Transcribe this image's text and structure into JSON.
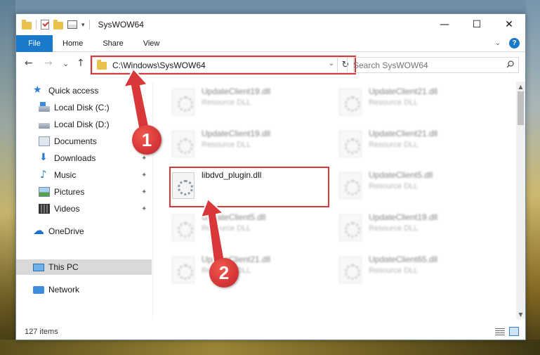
{
  "window": {
    "title": "SysWOW64",
    "controls": {
      "minimize": "—",
      "maximize": "☐",
      "close": "✕"
    }
  },
  "ribbon": {
    "tabs": [
      "File",
      "Home",
      "Share",
      "View"
    ],
    "help": "?"
  },
  "nav": {
    "back": "←",
    "forward": "→",
    "recent": "⌄",
    "up": "↑",
    "address": "C:\\Windows\\SysWOW64",
    "refresh": "↻",
    "search_placeholder": "Search SysWOW64"
  },
  "sidebar": {
    "items": [
      {
        "label": "Quick access",
        "icon": "star-icon",
        "pinned": false
      },
      {
        "label": "Local Disk (C:)",
        "icon": "drive-c-icon",
        "pinned": true
      },
      {
        "label": "Local Disk (D:)",
        "icon": "drive-icon",
        "pinned": false
      },
      {
        "label": "Documents",
        "icon": "documents-icon",
        "pinned": true
      },
      {
        "label": "Downloads",
        "icon": "downloads-icon",
        "pinned": true
      },
      {
        "label": "Music",
        "icon": "music-icon",
        "pinned": true
      },
      {
        "label": "Pictures",
        "icon": "pictures-icon",
        "pinned": true
      },
      {
        "label": "Videos",
        "icon": "videos-icon",
        "pinned": true
      },
      {
        "label": "OneDrive",
        "icon": "onedrive-icon",
        "pinned": false
      },
      {
        "label": "This PC",
        "icon": "this-pc-icon",
        "pinned": false
      },
      {
        "label": "Network",
        "icon": "network-icon",
        "pinned": false
      }
    ],
    "pin_glyph": "📌"
  },
  "files": [
    {
      "name": "UpdateClient19.dll",
      "type": "Resource DLL",
      "blurred": true
    },
    {
      "name": "UpdateClient21.dll",
      "type": "Resource DLL",
      "blurred": true
    },
    {
      "name": "UpdateClient19.dll",
      "type": "Resource DLL",
      "blurred": true
    },
    {
      "name": "UpdateClient21.dll",
      "type": "Resource DLL",
      "blurred": true
    },
    {
      "name": "libdvd_plugin.dll",
      "type": "",
      "blurred": false
    },
    {
      "name": "UpdateClient5.dll",
      "type": "Resource DLL",
      "blurred": true
    },
    {
      "name": "UpdateClient5.dll",
      "type": "Resource DLL",
      "blurred": true
    },
    {
      "name": "UpdateClient19.dll",
      "type": "Resource DLL",
      "blurred": true
    },
    {
      "name": "UpdateClient21.dll",
      "type": "Resource DLL",
      "blurred": true
    },
    {
      "name": "UpdateClient65.dll",
      "type": "Resource DLL",
      "blurred": true
    }
  ],
  "status": {
    "item_count": "127 items"
  },
  "annotations": {
    "step1": "1",
    "step2": "2"
  },
  "colors": {
    "accent": "#1979ca",
    "highlight": "#d9383a",
    "selected": "#d9d9d9"
  }
}
